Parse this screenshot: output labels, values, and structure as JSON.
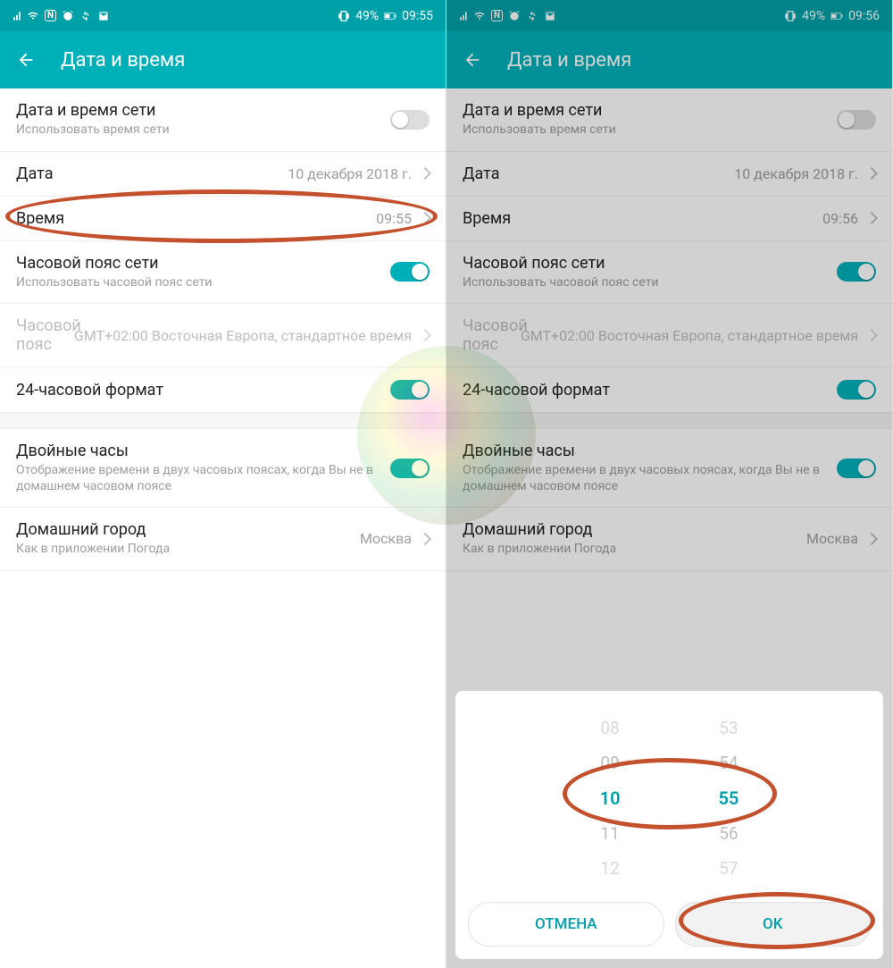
{
  "left": {
    "status": {
      "battery": "49%",
      "time": "09:55"
    },
    "header": {
      "title": "Дата и время"
    },
    "rows": {
      "auto": {
        "title": "Дата и время сети",
        "sub": "Использовать время сети"
      },
      "date": {
        "title": "Дата",
        "value": "10 декабря 2018 г."
      },
      "time": {
        "title": "Время",
        "value": "09:55"
      },
      "tzauto": {
        "title": "Часовой пояс сети",
        "sub": "Использовать часовой пояс сети"
      },
      "tz": {
        "title": "Часовой пояс",
        "value": "GMT+02:00 Восточная Европа, стандартное время"
      },
      "fmt24": {
        "title": "24-часовой формат"
      },
      "dual": {
        "title": "Двойные часы",
        "sub": "Отображение времени в двух часовых поясах, когда Вы не в домашнем часовом поясе"
      },
      "home": {
        "title": "Домашний город",
        "sub": "Как в приложении Погода",
        "value": "Москва"
      }
    }
  },
  "right": {
    "status": {
      "battery": "49%",
      "time": "09:56"
    },
    "header": {
      "title": "Дата и время"
    },
    "rows": {
      "auto": {
        "title": "Дата и время сети",
        "sub": "Использовать время сети"
      },
      "date": {
        "title": "Дата",
        "value": "10 декабря 2018 г."
      },
      "time": {
        "title": "Время",
        "value": "09:56"
      },
      "tzauto": {
        "title": "Часовой пояс сети",
        "sub": "Использовать часовой пояс сети"
      },
      "tz": {
        "title": "Часовой пояс",
        "value": "GMT+02:00 Восточная Европа, стандартное время"
      },
      "fmt24": {
        "title": "24-часовой формат"
      },
      "dual": {
        "title": "Двойные часы",
        "sub": "Отображение времени в двух часовых поясах, когда Вы не в домашнем часовом поясе"
      },
      "home": {
        "title": "Домашний город",
        "sub": "Как в приложении Погода",
        "value": "Москва"
      }
    },
    "picker": {
      "hours": [
        "08",
        "09",
        "10",
        "11",
        "12"
      ],
      "minutes": [
        "53",
        "54",
        "55",
        "56",
        "57"
      ],
      "cancel": "ОТМЕНА",
      "ok": "OK"
    }
  }
}
